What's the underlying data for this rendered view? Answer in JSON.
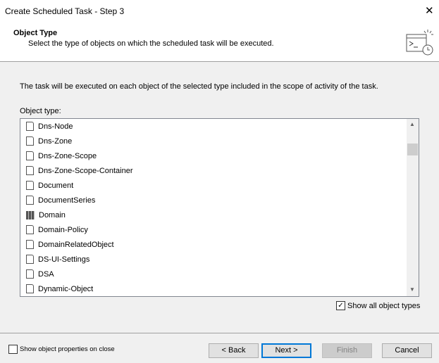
{
  "window": {
    "title": "Create Scheduled Task - Step 3",
    "close": "✕"
  },
  "header": {
    "title": "Object Type",
    "subtitle": "Select the type of objects on which the scheduled task will be executed."
  },
  "body": {
    "description": "The task will be executed on each object of the selected type included in the scope of activity of the task.",
    "list_label": "Object type:"
  },
  "items": [
    {
      "label": "Dns-Node",
      "icon": "document-icon"
    },
    {
      "label": "Dns-Zone",
      "icon": "document-icon"
    },
    {
      "label": "Dns-Zone-Scope",
      "icon": "document-icon"
    },
    {
      "label": "Dns-Zone-Scope-Container",
      "icon": "document-icon"
    },
    {
      "label": "Document",
      "icon": "document-icon"
    },
    {
      "label": "DocumentSeries",
      "icon": "document-icon"
    },
    {
      "label": "Domain",
      "icon": "domain-icon"
    },
    {
      "label": "Domain-Policy",
      "icon": "document-icon"
    },
    {
      "label": "DomainRelatedObject",
      "icon": "document-icon"
    },
    {
      "label": "DS-UI-Settings",
      "icon": "document-icon"
    },
    {
      "label": "DSA",
      "icon": "document-icon"
    },
    {
      "label": "Dynamic-Object",
      "icon": "document-icon"
    }
  ],
  "show_all": {
    "label": "Show all object types",
    "checked": true
  },
  "show_props": {
    "label": "Show object properties on close",
    "checked": false
  },
  "buttons": {
    "back": "< Back",
    "next": "Next >",
    "finish": "Finish",
    "cancel": "Cancel"
  }
}
